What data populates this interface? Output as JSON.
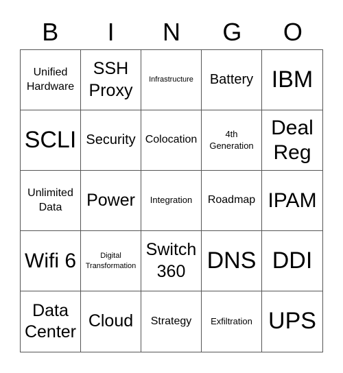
{
  "header": [
    "B",
    "I",
    "N",
    "G",
    "O"
  ],
  "cells": [
    {
      "text": "Unified Hardware",
      "size": "s3"
    },
    {
      "text": "SSH Proxy",
      "size": "s5"
    },
    {
      "text": "Infrastructure",
      "size": "s1"
    },
    {
      "text": "Battery",
      "size": "s4"
    },
    {
      "text": "IBM",
      "size": "s7"
    },
    {
      "text": "SCLI",
      "size": "s7"
    },
    {
      "text": "Security",
      "size": "s4"
    },
    {
      "text": "Colocation",
      "size": "s3"
    },
    {
      "text": "4th Generation",
      "size": "s2"
    },
    {
      "text": "Deal Reg",
      "size": "s6"
    },
    {
      "text": "Unlimited Data",
      "size": "s3"
    },
    {
      "text": "Power",
      "size": "s5"
    },
    {
      "text": "Integration",
      "size": "s2"
    },
    {
      "text": "Roadmap",
      "size": "s3"
    },
    {
      "text": "IPAM",
      "size": "s6"
    },
    {
      "text": "Wifi 6",
      "size": "s6"
    },
    {
      "text": "Digital Transformation",
      "size": "s1"
    },
    {
      "text": "Switch 360",
      "size": "s5"
    },
    {
      "text": "DNS",
      "size": "s7"
    },
    {
      "text": "DDI",
      "size": "s7"
    },
    {
      "text": "Data Center",
      "size": "s5"
    },
    {
      "text": "Cloud",
      "size": "s5"
    },
    {
      "text": "Strategy",
      "size": "s3"
    },
    {
      "text": "Exfiltration",
      "size": "s2"
    },
    {
      "text": "UPS",
      "size": "s7"
    }
  ]
}
